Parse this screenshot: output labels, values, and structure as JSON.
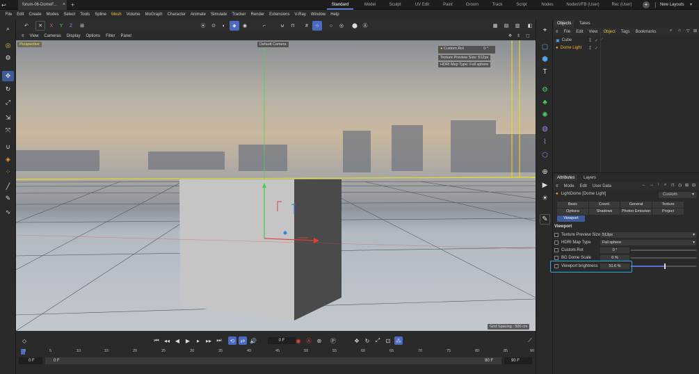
{
  "titlebar": {
    "doc_tab": "forum-06-DomeF...",
    "close_glyph": "×",
    "add_glyph": "+",
    "layouts": [
      "Standard",
      "Model",
      "Sculpt",
      "UV Edit",
      "Paint",
      "Groom",
      "Track",
      "Script",
      "Nodes",
      "NodesVFB (User)",
      "Rec (User)"
    ],
    "new_layouts": "New Layouts"
  },
  "menubar": {
    "items": [
      "File",
      "Edit",
      "Create",
      "Modes",
      "Select",
      "Tools",
      "Spline",
      "Mesh",
      "Volume",
      "MoGraph",
      "Character",
      "Animate",
      "Simulate",
      "Tracker",
      "Render",
      "Extensions",
      "V-Ray",
      "Window",
      "Help"
    ],
    "highlighted": "Mesh"
  },
  "axis_toolbar": {
    "x": "X",
    "y": "Y",
    "z": "Z"
  },
  "view_menu": {
    "items": [
      "View",
      "Cameras",
      "Display",
      "Options",
      "Filter",
      "Panel"
    ]
  },
  "viewport": {
    "perspective_label": "Perspective",
    "camera_label": "Default Camera",
    "hud": {
      "rotation": "Custom.Rot",
      "rotation_value": "0 °",
      "preview_size": "Texture Preview Size: 512px",
      "map_type": "HDRI Map Type: Full sphere"
    },
    "grid_spacing": "Grid Spacing : 500 cm"
  },
  "timeline": {
    "current_frame": "0 F",
    "ruler": [
      "0",
      "5",
      "10",
      "15",
      "20",
      "25",
      "30",
      "35",
      "40",
      "45",
      "50",
      "55",
      "60",
      "65",
      "70",
      "75",
      "80",
      "85",
      "90"
    ],
    "start_frame": "0 F",
    "range_start": "0 F",
    "range_end": "90 F",
    "end_frame": "90 F"
  },
  "objects_panel": {
    "tabs": [
      "Objects",
      "Takes"
    ],
    "menu": [
      "File",
      "Edit",
      "View",
      "Object",
      "Tags",
      "Bookmarks"
    ],
    "active_menu": "Object",
    "items": [
      {
        "name": "Cube",
        "icon": "cube-icon",
        "color": "#5aa0e8"
      },
      {
        "name": "Dome Light",
        "icon": "dome-light-icon",
        "color": "#f0b030"
      }
    ]
  },
  "attributes_panel": {
    "tabs": [
      "Attributes",
      "Layers"
    ],
    "menu": [
      "Mode",
      "Edit",
      "User Data"
    ],
    "object_name": "LightDome [Dome Light]",
    "preset": "Custom",
    "tab_buttons": [
      "Basic",
      "Coord.",
      "General",
      "Texture",
      "Options",
      "Shadows",
      "Photon Emission",
      "Project",
      "Viewport"
    ],
    "active_tab": "Viewport",
    "section": "Viewport",
    "params": [
      {
        "label": "Texture Preview Size",
        "value": "512px"
      },
      {
        "label": "HDRI Map Type",
        "value": "Full sphere"
      },
      {
        "label": "Custom.Rot",
        "value": "0 °"
      },
      {
        "label": "BG Dome Scale",
        "value": "0 %"
      },
      {
        "label": "Viewport brightness",
        "value": "51.6 %",
        "slider_fraction": 0.516
      }
    ],
    "highlight_color": "#2aa8e8"
  },
  "colors": {
    "accent": "#4a6bc0",
    "selection_blue": "#3d5a9a",
    "highlight_box": "#2aa8e8",
    "mesh_menu": "#f0c040"
  }
}
